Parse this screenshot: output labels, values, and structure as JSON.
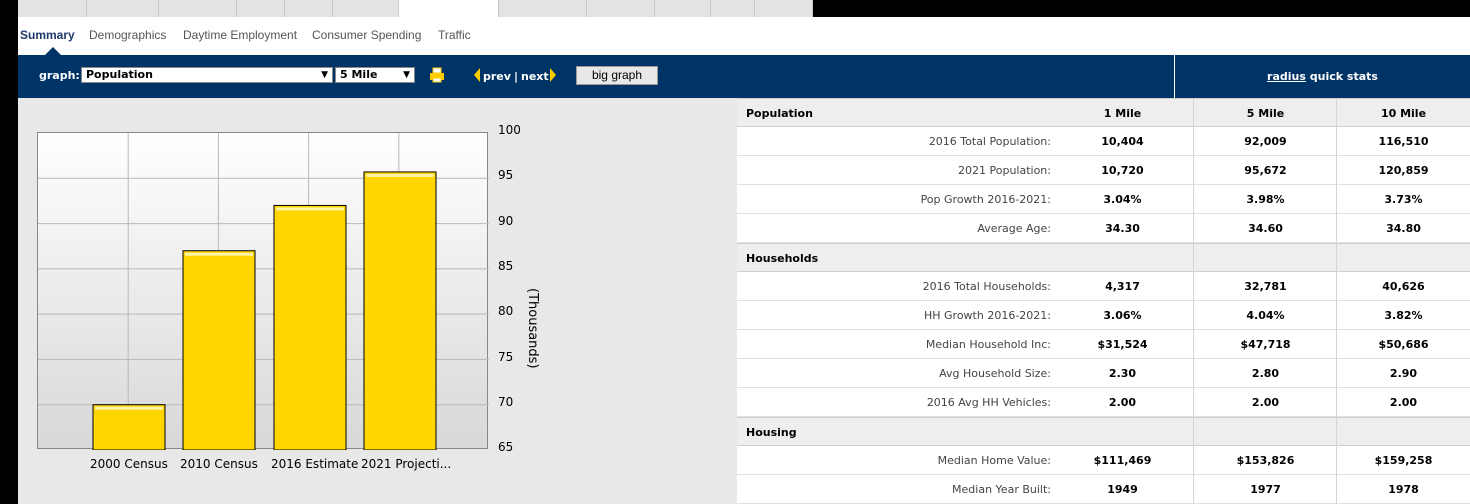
{
  "sub_tabs": [
    "Summary",
    "Demographics",
    "Daytime Employment",
    "Consumer Spending",
    "Traffic"
  ],
  "toolbar": {
    "graph_label": "graph:",
    "graph_select": "Population",
    "radius_select": "5 Mile",
    "prev_label": "prev",
    "divider": "|",
    "next_label": "next",
    "big_graph_label": "big graph",
    "quick_stats_link": "radius",
    "quick_stats_text": "quick stats"
  },
  "chart_data": {
    "type": "bar",
    "categories": [
      "2000 Census",
      "2010 Census",
      "2016 Estimate",
      "2021 Projecti..."
    ],
    "values": [
      70,
      87,
      92,
      95.7
    ],
    "ylim": [
      65,
      100
    ],
    "yticks": [
      "100",
      "95",
      "90",
      "85",
      "80",
      "75",
      "70",
      "65"
    ],
    "ylabel": "(Thousands)",
    "bar_color": "#ffd600",
    "grid": true
  },
  "table": {
    "columns": [
      "1 Mile",
      "5 Mile",
      "10 Mile"
    ],
    "sections": [
      {
        "title": "Population",
        "rows": [
          {
            "label": "2016 Total Population:",
            "values": [
              "10,404",
              "92,009",
              "116,510"
            ]
          },
          {
            "label": "2021 Population:",
            "values": [
              "10,720",
              "95,672",
              "120,859"
            ]
          },
          {
            "label": "Pop Growth 2016-2021:",
            "values": [
              "3.04%",
              "3.98%",
              "3.73%"
            ]
          },
          {
            "label": "Average Age:",
            "values": [
              "34.30",
              "34.60",
              "34.80"
            ]
          }
        ]
      },
      {
        "title": "Households",
        "rows": [
          {
            "label": "2016 Total Households:",
            "values": [
              "4,317",
              "32,781",
              "40,626"
            ]
          },
          {
            "label": "HH Growth 2016-2021:",
            "values": [
              "3.06%",
              "4.04%",
              "3.82%"
            ]
          },
          {
            "label": "Median Household Inc:",
            "values": [
              "$31,524",
              "$47,718",
              "$50,686"
            ]
          },
          {
            "label": "Avg Household Size:",
            "values": [
              "2.30",
              "2.80",
              "2.90"
            ]
          },
          {
            "label": "2016 Avg HH Vehicles:",
            "values": [
              "2.00",
              "2.00",
              "2.00"
            ]
          }
        ]
      },
      {
        "title": "Housing",
        "rows": [
          {
            "label": "Median Home Value:",
            "values": [
              "$111,469",
              "$153,826",
              "$159,258"
            ]
          },
          {
            "label": "Median Year Built:",
            "values": [
              "1949",
              "1977",
              "1978"
            ]
          }
        ]
      }
    ]
  },
  "colors": {
    "header_bg": "#003366",
    "accent_arrow": "#ffcc00"
  }
}
